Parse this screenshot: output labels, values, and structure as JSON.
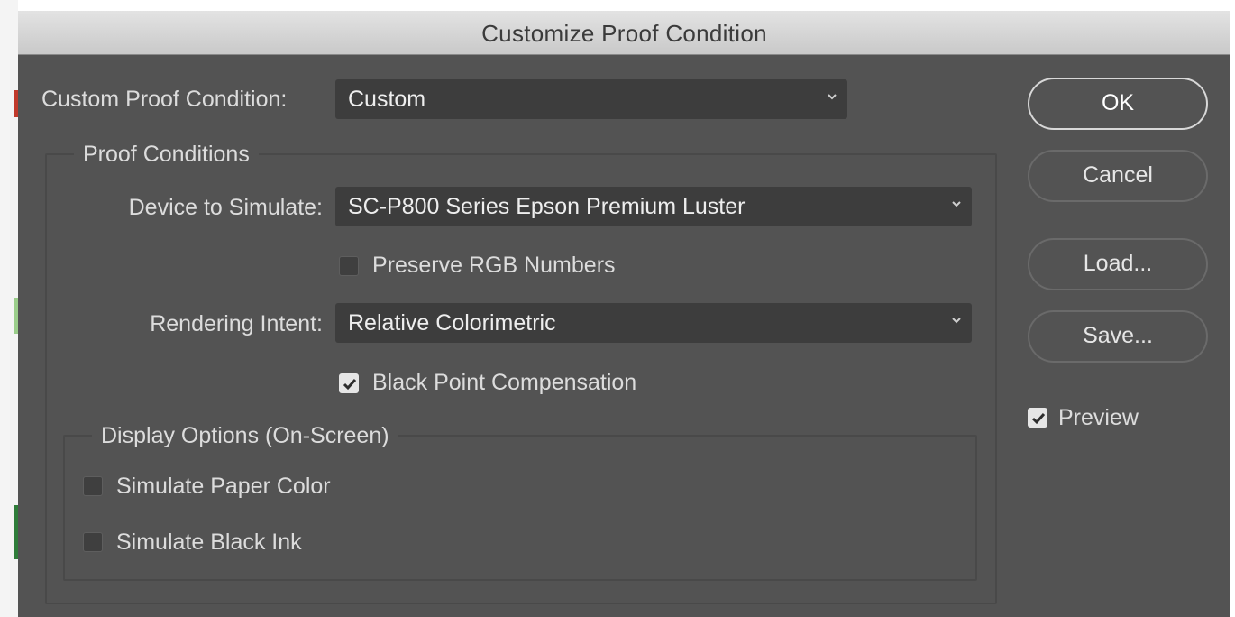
{
  "window": {
    "title": "Customize Proof Condition"
  },
  "custom_proof": {
    "label": "Custom Proof Condition:",
    "value": "Custom"
  },
  "proof_conditions": {
    "group_title": "Proof Conditions",
    "device_label": "Device to Simulate:",
    "device_value": "SC-P800 Series Epson Premium Luster",
    "preserve_rgb": {
      "label": "Preserve RGB Numbers",
      "checked": false
    },
    "rendering_label": "Rendering Intent:",
    "rendering_value": "Relative Colorimetric",
    "black_point": {
      "label": "Black Point Compensation",
      "checked": true
    }
  },
  "display_options": {
    "group_title": "Display Options (On-Screen)",
    "simulate_paper": {
      "label": "Simulate Paper Color",
      "checked": false
    },
    "simulate_ink": {
      "label": "Simulate Black Ink",
      "checked": false
    }
  },
  "buttons": {
    "ok": "OK",
    "cancel": "Cancel",
    "load": "Load...",
    "save": "Save..."
  },
  "preview": {
    "label": "Preview",
    "checked": true
  },
  "icons": {
    "dropdown": "chevron-down-icon",
    "check": "checkmark-icon"
  },
  "colors": {
    "dialog_bg": "#535353",
    "field_bg": "#3d3d3d",
    "titlebar": "#d6d6d6"
  }
}
